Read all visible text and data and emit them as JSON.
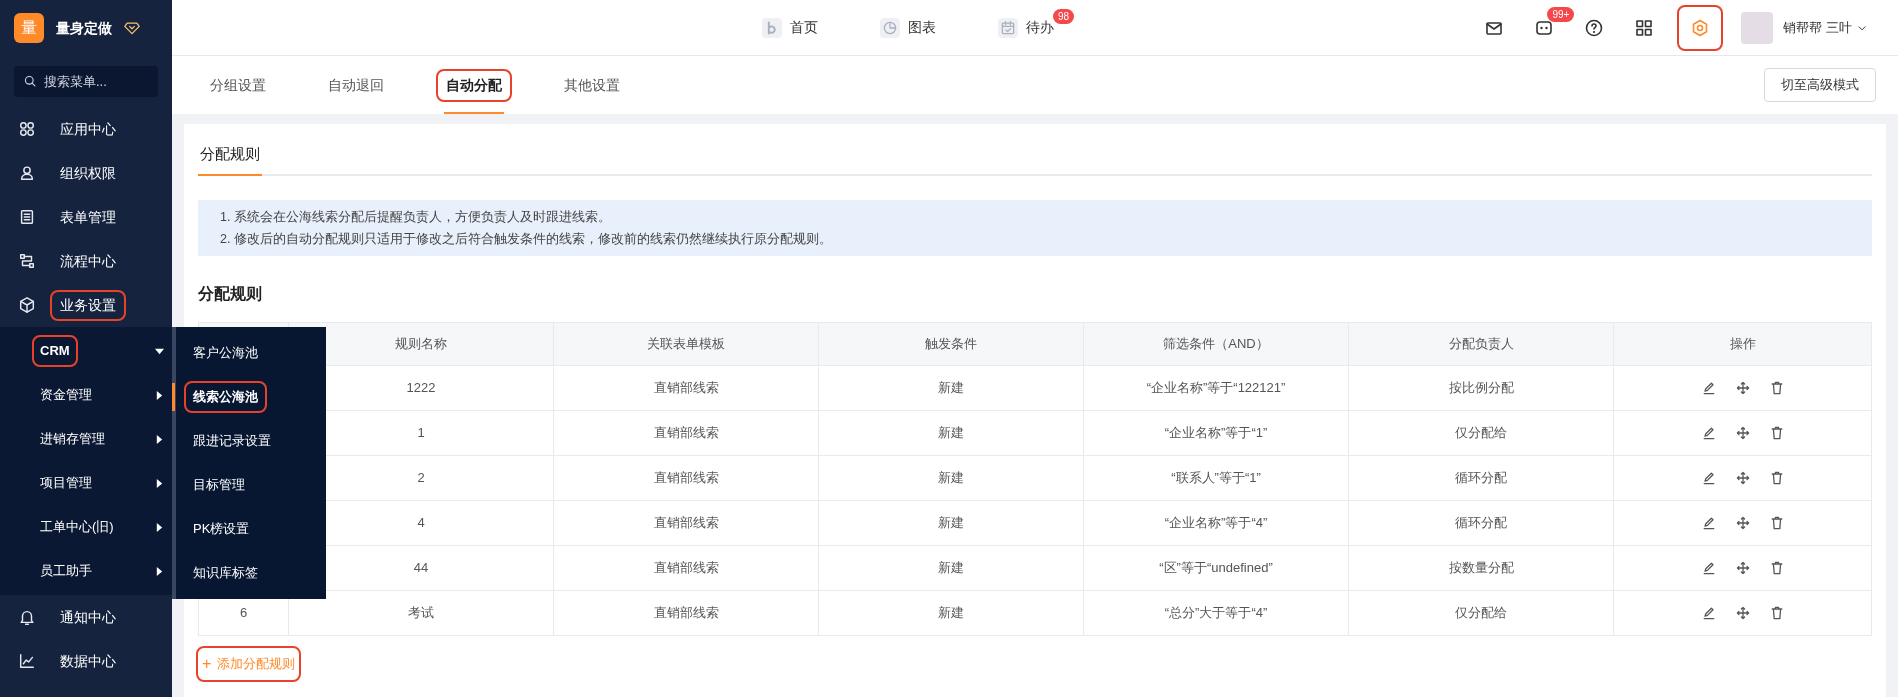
{
  "brand": {
    "logo": "量",
    "name": "量身定做"
  },
  "sidebar": {
    "search": {
      "placeholder": "搜索菜单..."
    },
    "items": [
      {
        "label": "应用中心",
        "annotated": false
      },
      {
        "label": "组织权限",
        "annotated": false
      },
      {
        "label": "表单管理",
        "annotated": false
      },
      {
        "label": "流程中心",
        "annotated": false
      },
      {
        "label": "业务设置",
        "expanded": true,
        "annotated": true,
        "children": [
          {
            "label": "CRM",
            "expanded": true,
            "annotated": true
          },
          {
            "label": "资金管理",
            "expanded": false,
            "annotated": false
          },
          {
            "label": "进销存管理",
            "expanded": false,
            "annotated": false
          },
          {
            "label": "项目管理",
            "expanded": false,
            "annotated": false
          },
          {
            "label": "工单中心(旧)",
            "expanded": false,
            "annotated": false
          },
          {
            "label": "员工助手",
            "expanded": false,
            "annotated": false
          }
        ]
      },
      {
        "label": "通知中心",
        "annotated": false
      },
      {
        "label": "数据中心",
        "annotated": false
      }
    ],
    "flyout": [
      {
        "label": "客户公海池",
        "selected": false,
        "annotated": false
      },
      {
        "label": "线索公海池",
        "selected": true,
        "annotated": true
      },
      {
        "label": "跟进记录设置",
        "selected": false,
        "annotated": false
      },
      {
        "label": "目标管理",
        "selected": false,
        "annotated": false
      },
      {
        "label": "PK榜设置",
        "selected": false,
        "annotated": false
      },
      {
        "label": "知识库标签",
        "selected": false,
        "annotated": false
      }
    ]
  },
  "top_nav": [
    {
      "label": "首页"
    },
    {
      "label": "图表"
    },
    {
      "label": "待办",
      "badge": "98"
    }
  ],
  "toolbar": [
    {
      "annotated": false
    },
    {
      "badge": "99+",
      "annotated": false
    },
    {
      "annotated": false
    },
    {
      "annotated": false
    },
    {
      "annotated": true
    }
  ],
  "user": {
    "name": "销帮帮 三叶"
  },
  "tabs": [
    {
      "label": "分组设置",
      "selected": false,
      "annotated": false
    },
    {
      "label": "自动退回",
      "selected": false,
      "annotated": false
    },
    {
      "label": "自动分配",
      "selected": true,
      "annotated": true
    },
    {
      "label": "其他设置",
      "selected": false,
      "annotated": false
    }
  ],
  "advanced_button": "切至高级模式",
  "sub_tabs": [
    {
      "label": "分配规则",
      "selected": true
    }
  ],
  "notice": [
    "1. 系统会在公海线索分配后提醒负责人，方便负责人及时跟进线索。",
    "2. 修改后的自动分配规则只适用于修改之后符合触发条件的线索，修改前的线索仍然继续执行原分配规则。"
  ],
  "section_title": "分配规则",
  "table": {
    "columns": [
      "规则名称",
      "关联表单模板",
      "触发条件",
      "筛选条件（AND）",
      "分配负责人",
      "操作"
    ],
    "rows": [
      {
        "cells": [
          "1222",
          "直销部线索",
          "新建",
          "“企业名称”等于“122121”",
          "按比例分配"
        ]
      },
      {
        "cells": [
          "1",
          "直销部线索",
          "新建",
          "“企业名称”等于“1”",
          "仅分配给"
        ]
      },
      {
        "cells": [
          "2",
          "直销部线索",
          "新建",
          "“联系人”等于“1”",
          "循环分配"
        ]
      },
      {
        "cells": [
          "4",
          "直销部线索",
          "新建",
          "“企业名称”等于“4”",
          "循环分配"
        ]
      },
      {
        "cells": [
          "44",
          "直销部线索",
          "新建",
          "“区”等于“undefined”",
          "按数量分配"
        ]
      },
      {
        "index": "6",
        "cells": [
          "考试",
          "直销部线索",
          "新建",
          "“总分”大于等于“4”",
          "仅分配给"
        ]
      }
    ]
  },
  "add_button": {
    "icon": "+",
    "label": "添加分配规则",
    "annotated": true
  }
}
